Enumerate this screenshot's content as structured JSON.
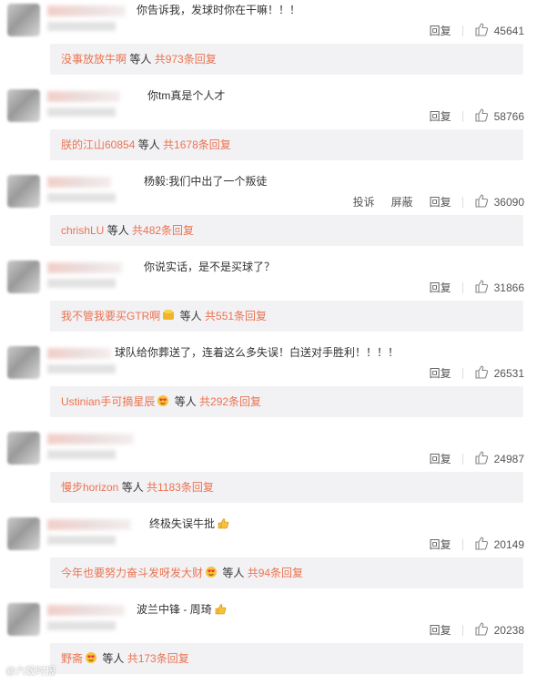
{
  "comments": [
    {
      "text": "你告诉我，发球时你在干嘛！！！",
      "actions": [
        "回复"
      ],
      "likes": "45641",
      "reply_user": "没事放放牛啊",
      "reply_mid": " 等人 ",
      "reply_total": "共973条回复"
    },
    {
      "text": "你tm真是个人才",
      "actions": [
        "回复"
      ],
      "likes": "58766",
      "reply_user": "朕的江山60854",
      "reply_mid": " 等人 ",
      "reply_total": "共1678条回复"
    },
    {
      "text": "杨毅:我们中出了一个叛徒",
      "actions": [
        "投诉",
        "屏蔽",
        "回复"
      ],
      "likes": "36090",
      "reply_user": "chrishLU",
      "reply_mid": " 等人 ",
      "reply_total": "共482条回复"
    },
    {
      "text": "你说实话，是不是买球了？",
      "actions": [
        "回复"
      ],
      "likes": "31866",
      "reply_user": "我不管我要买GTR啊",
      "reply_emoji": "gold-coin-icon",
      "reply_mid": " 等人 ",
      "reply_total": "共551条回复"
    },
    {
      "text": "球队给你葬送了，连着这么多失误！白送对手胜利！！！！",
      "actions": [
        "回复"
      ],
      "likes": "26531",
      "reply_user": "Ustinian手可摘星辰",
      "reply_emoji": "heart-eyes-icon",
      "reply_mid": " 等人 ",
      "reply_total": "共292条回复"
    },
    {
      "text": "",
      "actions": [
        "回复"
      ],
      "likes": "24987",
      "reply_user": "慢步horizon",
      "reply_mid": " 等人 ",
      "reply_total": "共1183条回复"
    },
    {
      "text": "终极失误牛批",
      "text_emoji": "thumbs-up-icon",
      "actions": [
        "回复"
      ],
      "likes": "20149",
      "reply_user": "今年也要努力奋斗发呀发大财",
      "reply_emoji": "heart-eyes-icon",
      "reply_mid": " 等人 ",
      "reply_total": "共94条回复"
    },
    {
      "text": "波兰中锋 - 周琦",
      "text_emoji": "thumbs-up-icon",
      "actions": [
        "回复"
      ],
      "likes": "20238",
      "reply_user": "野斋",
      "reply_emoji": "heart-eyes-icon",
      "reply_mid": " 等人 ",
      "reply_total": "共173条回复"
    }
  ],
  "watermark": "@六毂时报",
  "colors": {
    "link": "#eb7350",
    "reply_bg": "#f2f2f5"
  }
}
